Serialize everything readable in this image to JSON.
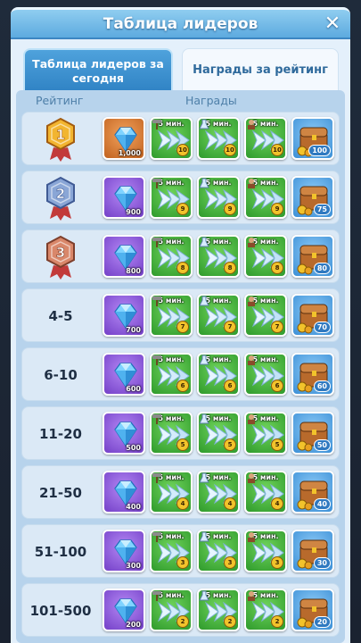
{
  "window": {
    "title": "Таблица лидеров",
    "close_icon": "close-icon"
  },
  "tabs": [
    {
      "label": "Таблица лидеров за сегодня",
      "active": true
    },
    {
      "label": "Награды за рейтинг",
      "active": false
    }
  ],
  "columns": {
    "rank": "Рейтинг",
    "rewards": "Награды"
  },
  "rows": [
    {
      "rank": "1",
      "badge": "gold-medal-1",
      "gem": {
        "qty": "1,000",
        "frame": "orange"
      },
      "boost": "5 мин.",
      "b1": "10",
      "b2": "10",
      "b3": "10",
      "chest": "100"
    },
    {
      "rank": "2",
      "badge": "silver-medal-2",
      "gem": {
        "qty": "900",
        "frame": "purple"
      },
      "boost": "5 мин.",
      "b1": "9",
      "b2": "9",
      "b3": "9",
      "chest": "75"
    },
    {
      "rank": "3",
      "badge": "bronze-medal-3",
      "gem": {
        "qty": "800",
        "frame": "purple"
      },
      "boost": "5 мин.",
      "b1": "8",
      "b2": "8",
      "b3": "8",
      "chest": "80"
    },
    {
      "rank": "4-5",
      "badge": "",
      "gem": {
        "qty": "700",
        "frame": "purple"
      },
      "boost": "5 мин.",
      "b1": "7",
      "b2": "7",
      "b3": "7",
      "chest": "70"
    },
    {
      "rank": "6-10",
      "badge": "",
      "gem": {
        "qty": "600",
        "frame": "purple"
      },
      "boost": "5 мин.",
      "b1": "6",
      "b2": "6",
      "b3": "6",
      "chest": "60"
    },
    {
      "rank": "11-20",
      "badge": "",
      "gem": {
        "qty": "500",
        "frame": "purple"
      },
      "boost": "5 мин.",
      "b1": "5",
      "b2": "5",
      "b3": "5",
      "chest": "50"
    },
    {
      "rank": "21-50",
      "badge": "",
      "gem": {
        "qty": "400",
        "frame": "purple"
      },
      "boost": "5 мин.",
      "b1": "4",
      "b2": "4",
      "b3": "4",
      "chest": "40"
    },
    {
      "rank": "51-100",
      "badge": "",
      "gem": {
        "qty": "300",
        "frame": "purple"
      },
      "boost": "5 мин.",
      "b1": "3",
      "b2": "3",
      "b3": "3",
      "chest": "30"
    },
    {
      "rank": "101-500",
      "badge": "",
      "gem": {
        "qty": "200",
        "frame": "purple"
      },
      "boost": "5 мин.",
      "b1": "2",
      "b2": "2",
      "b3": "2",
      "chest": "20"
    }
  ],
  "icons": {
    "gem": "blue-diamond-icon",
    "boost_build": "speedup-hammer-icon",
    "boost_research": "speedup-flask-icon",
    "boost_train": "speedup-soldier-icon",
    "chest": "resource-chest-icon"
  },
  "colors": {
    "gold": "#f2b530",
    "silver": "#8aa6d6",
    "bronze": "#d9876a",
    "title_blue": "#5aa8de"
  }
}
